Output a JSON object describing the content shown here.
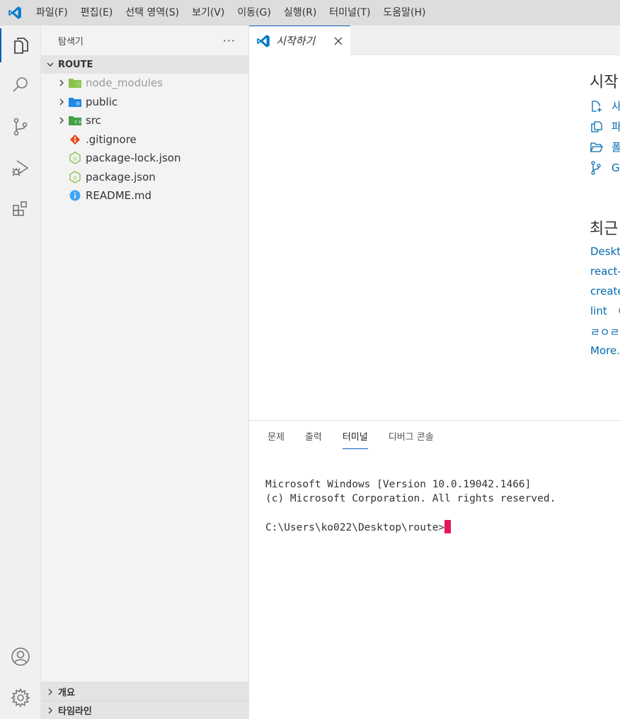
{
  "menubar": {
    "items": [
      "파일(F)",
      "편집(E)",
      "선택 영역(S)",
      "보기(V)",
      "이동(G)",
      "실행(R)",
      "터미널(T)",
      "도움말(H)"
    ]
  },
  "activitybar": {
    "icons": [
      "explorer-icon",
      "search-icon",
      "source-control-icon",
      "run-debug-icon",
      "extensions-icon",
      "account-icon",
      "settings-gear-icon"
    ]
  },
  "sidebar": {
    "title": "탐색기",
    "more": "···",
    "folder": "ROUTE",
    "items": [
      {
        "label": "node_modules",
        "type": "folder",
        "icon": "node-folder-icon",
        "dim": true
      },
      {
        "label": "public",
        "type": "folder",
        "icon": "public-folder-icon",
        "dim": false
      },
      {
        "label": "src",
        "type": "folder",
        "icon": "src-folder-icon",
        "dim": false
      },
      {
        "label": ".gitignore",
        "type": "file",
        "icon": "git-icon"
      },
      {
        "label": "package-lock.json",
        "type": "file",
        "icon": "nodejs-icon"
      },
      {
        "label": "package.json",
        "type": "file",
        "icon": "nodejs-icon"
      },
      {
        "label": "README.md",
        "type": "file",
        "icon": "info-icon"
      }
    ],
    "outline": "개요",
    "timeline": "타임라인"
  },
  "tab": {
    "label": "시작하기",
    "close": "×"
  },
  "welcome": {
    "start_heading": "시작",
    "start_links": [
      {
        "label": "사",
        "icon": "new-file-icon"
      },
      {
        "label": "파",
        "icon": "open-file-icon"
      },
      {
        "label": "폴",
        "icon": "open-folder-icon"
      },
      {
        "label": "Gi",
        "icon": "git-branch-icon"
      }
    ],
    "recent_heading": "최근",
    "recent": [
      {
        "name": "Deskto",
        "path": ""
      },
      {
        "name": "react-r",
        "path": ""
      },
      {
        "name": "create",
        "path": ""
      },
      {
        "name": "lint",
        "path": "C"
      },
      {
        "name": "ㄹㅇㄹ",
        "path": ""
      },
      {
        "name": "More...",
        "path": ""
      }
    ]
  },
  "panel": {
    "tabs": [
      "문제",
      "출력",
      "터미널",
      "디버그 콘솔"
    ],
    "active_tab": "터미널",
    "terminal_lines": [
      "Microsoft Windows [Version 10.0.19042.1466]",
      "(c) Microsoft Corporation. All rights reserved.",
      "",
      "C:\\Users\\ko022\\Desktop\\route>"
    ]
  },
  "colors": {
    "accent": "#005fb8",
    "link": "#006ab1",
    "cursor": "#e5165d",
    "vscode_logo": "#007acc"
  }
}
